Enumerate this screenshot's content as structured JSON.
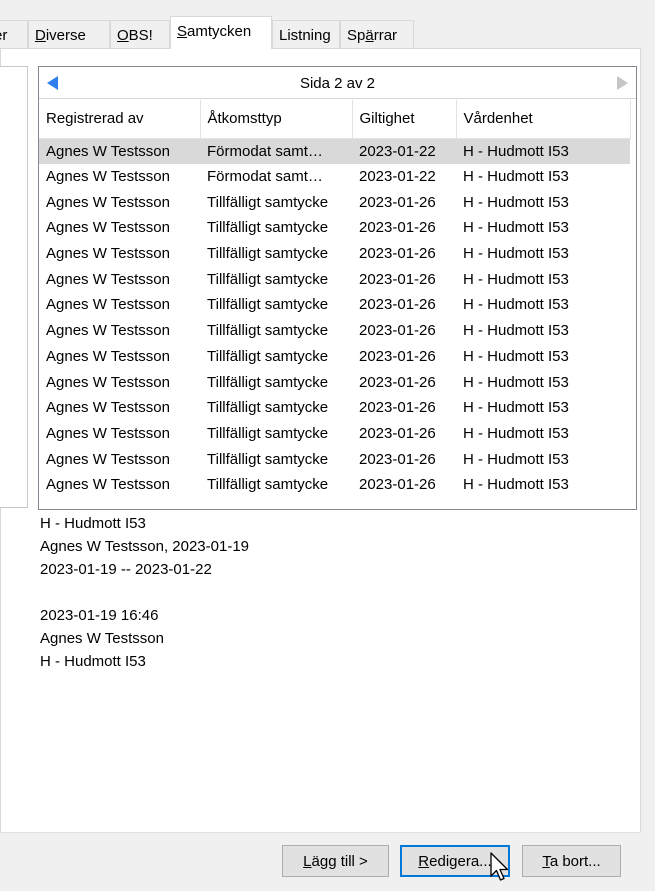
{
  "tabs": [
    {
      "label": "er",
      "mn": "",
      "rest": "er"
    },
    {
      "label": "Diverse",
      "mn": "D",
      "rest": "iverse"
    },
    {
      "label": "OBS!",
      "mn": "O",
      "rest": "BS!"
    },
    {
      "label": "Samtycken",
      "mn": "S",
      "rest": "amtycken"
    },
    {
      "label": "Listning",
      "pre": "Listnin",
      "mn": "g",
      "rest": ""
    },
    {
      "label": "Spärrar",
      "pre": "Sp",
      "mn": "ä",
      "rest": "rrar"
    }
  ],
  "pager": {
    "label": "Sida 2 av 2"
  },
  "table": {
    "columns": [
      "Registrerad av",
      "Åtkomsttyp",
      "Giltighet",
      "Vårdenhet"
    ],
    "rows": [
      [
        "Agnes W Testsson",
        "Förmodat samt…",
        "2023-01-22",
        "H - Hudmott I53"
      ],
      [
        "Agnes W Testsson",
        "Förmodat samt…",
        "2023-01-22",
        "H - Hudmott I53"
      ],
      [
        "Agnes W Testsson",
        "Tillfälligt samtycke",
        "2023-01-26",
        "H - Hudmott I53"
      ],
      [
        "Agnes W Testsson",
        "Tillfälligt samtycke",
        "2023-01-26",
        "H - Hudmott I53"
      ],
      [
        "Agnes W Testsson",
        "Tillfälligt samtycke",
        "2023-01-26",
        "H - Hudmott I53"
      ],
      [
        "Agnes W Testsson",
        "Tillfälligt samtycke",
        "2023-01-26",
        "H - Hudmott I53"
      ],
      [
        "Agnes W Testsson",
        "Tillfälligt samtycke",
        "2023-01-26",
        "H - Hudmott I53"
      ],
      [
        "Agnes W Testsson",
        "Tillfälligt samtycke",
        "2023-01-26",
        "H - Hudmott I53"
      ],
      [
        "Agnes W Testsson",
        "Tillfälligt samtycke",
        "2023-01-26",
        "H - Hudmott I53"
      ],
      [
        "Agnes W Testsson",
        "Tillfälligt samtycke",
        "2023-01-26",
        "H - Hudmott I53"
      ],
      [
        "Agnes W Testsson",
        "Tillfälligt samtycke",
        "2023-01-26",
        "H - Hudmott I53"
      ],
      [
        "Agnes W Testsson",
        "Tillfälligt samtycke",
        "2023-01-26",
        "H - Hudmott I53"
      ],
      [
        "Agnes W Testsson",
        "Tillfälligt samtycke",
        "2023-01-26",
        "H - Hudmott I53"
      ],
      [
        "Agnes W Testsson",
        "Tillfälligt samtycke",
        "2023-01-26",
        "H - Hudmott I53"
      ]
    ]
  },
  "details": {
    "line1": "H - Hudmott I53",
    "line2": "Agnes W Testsson, 2023-01-19",
    "line3": "2023-01-19 -- 2023-01-22",
    "line4": "",
    "line5": "2023-01-19 16:46",
    "line6": "Agnes W Testsson",
    "line7": "H - Hudmott I53"
  },
  "buttons": {
    "add": {
      "label": "Lägg till >",
      "mn": "L",
      "rest": "ägg till >"
    },
    "edit": {
      "label": "Redigera...",
      "mn": "R",
      "rest": "edigera..."
    },
    "remove": {
      "label": "Ta bort...",
      "mn": "T",
      "rest": "a bort..."
    }
  },
  "colors": {
    "selected_row": "#d9d9d9",
    "arrow_active": "#2f80ed",
    "arrow_disabled": "#c6c6c6",
    "focus_border": "#0078d7"
  },
  "icons": {
    "prev": "triangle-left-icon",
    "next": "triangle-right-icon",
    "cursor": "mouse-pointer-icon"
  }
}
